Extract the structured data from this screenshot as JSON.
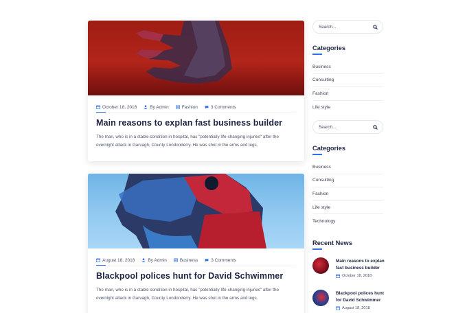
{
  "posts": [
    {
      "date": "October 18, 2018",
      "author": "By Admin",
      "category": "Fashion",
      "comments": "3 Comments",
      "title": "Main reasons to explan fast business builder",
      "excerpt": "The man, who is in a stable condition in hospital, has \"potentially life-changing injuries\" after the overnight attack in Garvagh, County Londonderry. He was shot in the arms and legs."
    },
    {
      "date": "August 18, 2018",
      "author": "By Admin",
      "category": "Business",
      "comments": "3 Comments",
      "title": "Blackpool polices hunt for David Schwimmer",
      "excerpt": "The man, who is in a stable condition in hospital, has \"potentially life-changing injuries\" after the overnight attack in Garvagh, County Londonderry. He was shot in the arms and legs."
    }
  ],
  "sidebar": {
    "search_placeholder": "Search...",
    "categories_title_1": "Categories",
    "categories_1": [
      "Business",
      "Consulting",
      "Fashion",
      "Life style"
    ],
    "categories_title_2": "Categories",
    "categories_2": [
      "Business",
      "Consulting",
      "Fashion",
      "Life style",
      "Technology"
    ],
    "recent_title": "Recent News",
    "recent": [
      {
        "title": "Main reasons to explan fast business builder",
        "date": "October 18, 2018"
      },
      {
        "title": "Blackpool polices hunt for David Schwimmer",
        "date": "August 18, 2018"
      }
    ]
  },
  "icons": {
    "calendar": "calendar-icon",
    "user": "user-icon",
    "folder": "folder-icon",
    "comment": "comment-icon",
    "search": "search-icon"
  },
  "colors": {
    "accent": "#2f6fe8",
    "heading": "#1d2541",
    "text": "#4c5466"
  }
}
